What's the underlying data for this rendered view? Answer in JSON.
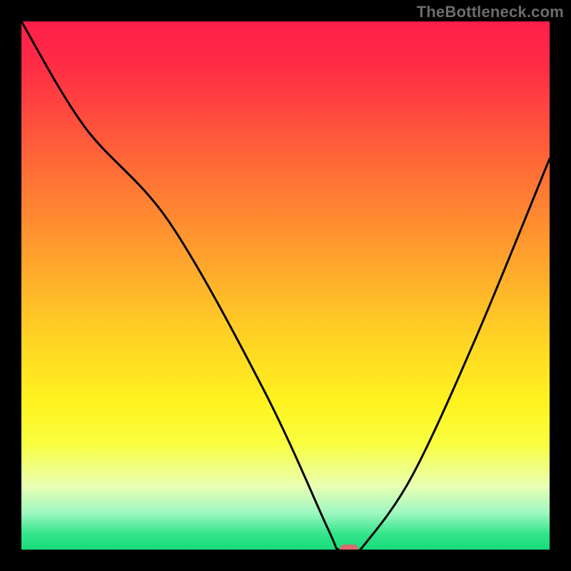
{
  "watermark": "TheBottleneck.com",
  "colors": {
    "frame": "#000000",
    "curve": "#000000",
    "marker": "#d96a6f",
    "watermark_text": "#6c6c6c",
    "gradient_stops": [
      "#ff1f4a",
      "#ff2b46",
      "#ff4b3e",
      "#ff7a34",
      "#ffa62c",
      "#ffd324",
      "#fff31f",
      "#f9ff40",
      "#e9ffb3",
      "#9ff7c1",
      "#34e58b",
      "#18db7a"
    ]
  },
  "chart_data": {
    "type": "line",
    "title": "",
    "xlabel": "",
    "ylabel": "",
    "xlim": [
      0,
      100
    ],
    "ylim": [
      0,
      100
    ],
    "series": [
      {
        "name": "bottleneck-curve",
        "x": [
          0,
          12,
          28,
          46,
          58,
          60,
          63,
          65,
          74,
          86,
          100
        ],
        "values": [
          100,
          80,
          62,
          30,
          4,
          0,
          0,
          1,
          14,
          40,
          74
        ]
      }
    ],
    "marker": {
      "x": 62,
      "y": 0,
      "name": "optimal-point"
    }
  }
}
